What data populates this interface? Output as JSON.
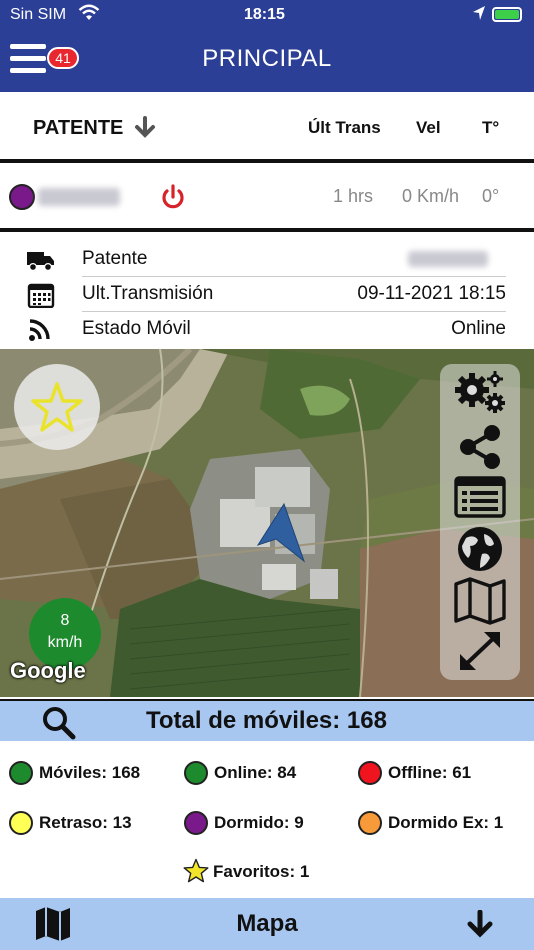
{
  "status_bar": {
    "carrier": "Sin SIM",
    "time": "18:15"
  },
  "header": {
    "title": "PRINCIPAL",
    "badge_count": "41"
  },
  "columns": {
    "patente": "PATENTE",
    "ult_trans": "Últ Trans",
    "vel": "Vel",
    "temp": "T°"
  },
  "vehicle_row": {
    "status_color": "#7a1a8a",
    "time": "1 hrs",
    "speed": "0 Km/h",
    "temp": "0°"
  },
  "details": [
    {
      "icon": "truck-icon",
      "label": "Patente",
      "value": ""
    },
    {
      "icon": "calendar-icon",
      "label": "Ult.Transmisión",
      "value": "09-11-2021 18:15"
    },
    {
      "icon": "rss-icon",
      "label": "Estado Móvil",
      "value": "Online"
    }
  ],
  "map": {
    "speed_value": "8",
    "speed_unit": "km/h",
    "provider": "Google",
    "controls": [
      "gear-icon",
      "share-icon",
      "list-icon",
      "globe-icon",
      "map-icon",
      "expand-icon"
    ]
  },
  "total": {
    "label": "Total de móviles: 168"
  },
  "legend": [
    {
      "label": "Móviles: 168",
      "color": "#1e8a2e"
    },
    {
      "label": "Online: 84",
      "color": "#1e8a2e"
    },
    {
      "label": "Offline: 61",
      "color": "#f0141e"
    },
    {
      "label": "Retraso: 13",
      "color": "#ffff55"
    },
    {
      "label": "Dormido: 9",
      "color": "#7a1a8a"
    },
    {
      "label": "Dormido Ex: 1",
      "color": "#f79a3a"
    },
    {
      "label": "Favoritos: 1",
      "color": "#f2e62a"
    }
  ],
  "bottom_bar": {
    "label": "Mapa"
  },
  "colors": {
    "header": "#2c3f96",
    "accent_bar": "#a7c7f0",
    "badge": "#e8282e"
  }
}
